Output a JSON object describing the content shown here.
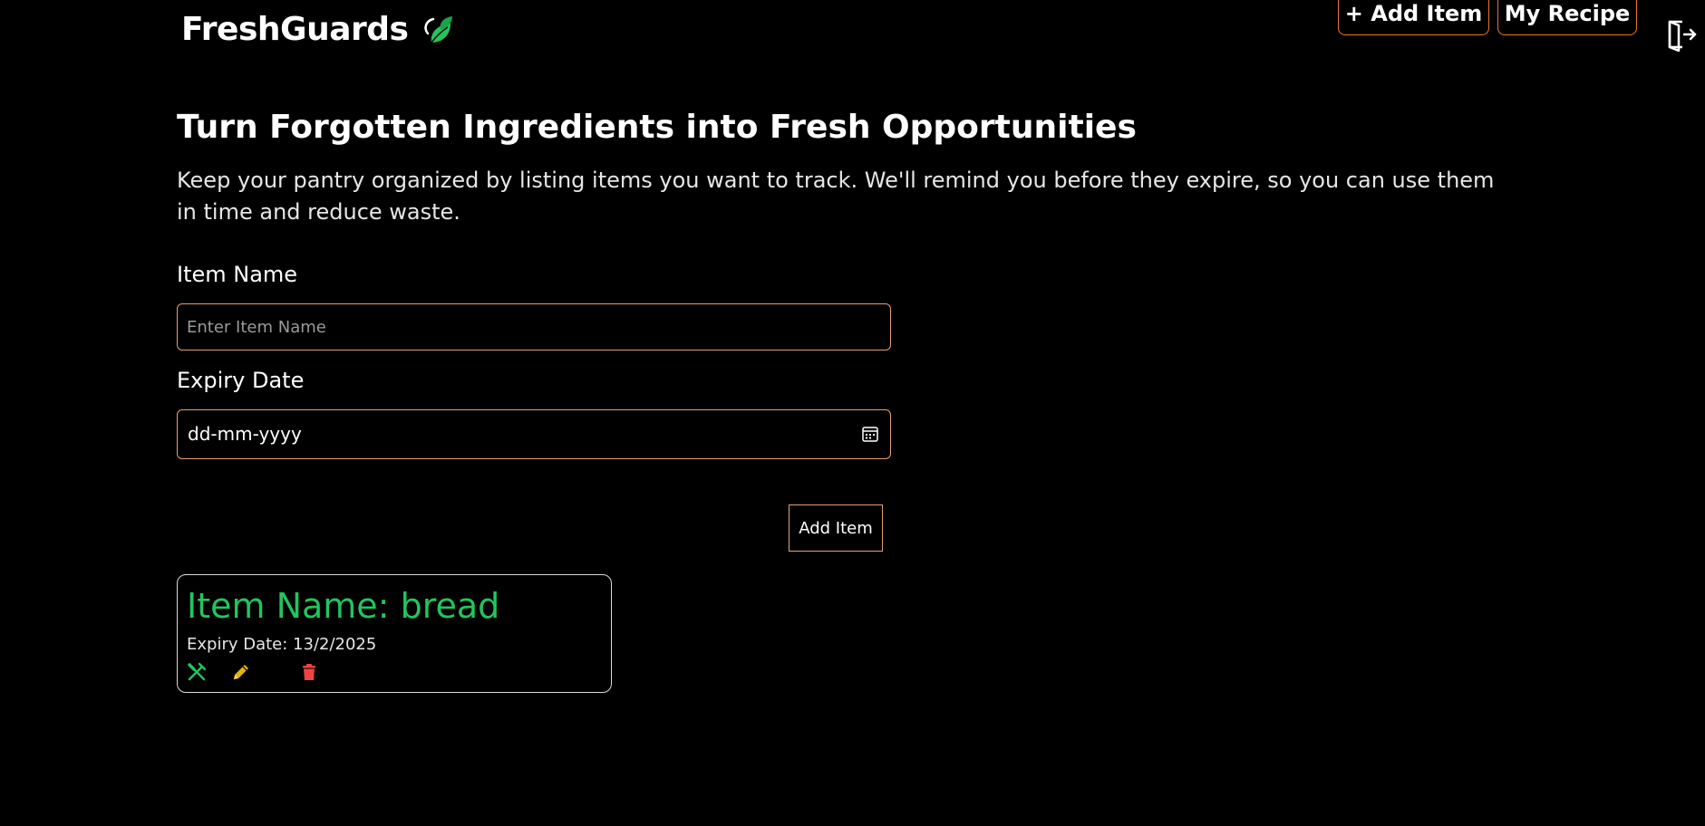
{
  "header": {
    "brand": "FreshGuards",
    "add_item_label": "+ Add Item",
    "my_recipe_label": "My Recipe"
  },
  "icons": {
    "brand": "leaf-icon",
    "logout": "logout-icon",
    "calendar": "calendar-icon",
    "cook": "fork-knife-icon",
    "edit": "pencil-icon",
    "delete": "trash-icon"
  },
  "colors": {
    "accent": "#e8772e",
    "item_title": "#22c55e",
    "edit": "#eab308",
    "delete": "#ef4444",
    "background": "#000000"
  },
  "hero": {
    "title": "Turn Forgotten Ingredients into Fresh Opportunities",
    "description": "Keep your pantry organized by listing items you want to track. We'll remind you before they expire, so you can use them in time and reduce waste."
  },
  "form": {
    "item_name_label": "Item Name",
    "item_name_placeholder": "Enter Item Name",
    "item_name_value": "",
    "expiry_label": "Expiry Date",
    "expiry_value": "dd-mm-yyyy",
    "submit_label": "Add Item"
  },
  "items": [
    {
      "title": "Item Name: bread",
      "expiry": "Expiry Date: 13/2/2025"
    }
  ]
}
